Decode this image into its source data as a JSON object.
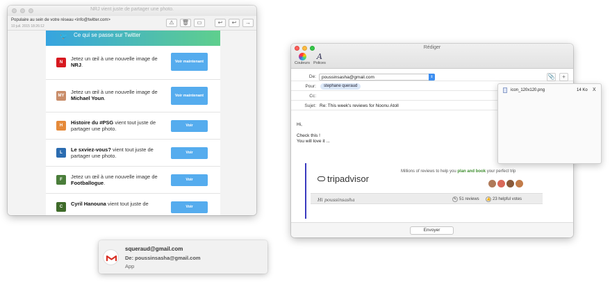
{
  "mail_viewer": {
    "window_title": "NRJ vient juste de partager une photo.",
    "from": "Populaire au sein de votre réseau <info@twitter.com>",
    "date": "10 juil. 2015 18:26:12",
    "toolbar_icons": [
      "warning-icon",
      "trash-icon",
      "folder-icon",
      "reply-icon",
      "reply-all-icon",
      "forward-icon"
    ],
    "twitter_banner": "Ce qui se passe sur Twitter",
    "items": [
      {
        "text_before": "Jetez un œil à une nouvelle image de ",
        "bold": "NRJ",
        "text_after": ".",
        "button": "Voir maintenant"
      },
      {
        "text_before": "Jetez un œil à une nouvelle image de ",
        "bold": "Michael Youn",
        "text_after": ".",
        "button": "Voir maintenant"
      },
      {
        "text_before": "",
        "bold": "Histoire du #PSG",
        "text_after": " vient tout juste de partager une photo.",
        "button": "Voir"
      },
      {
        "text_before": "",
        "bold": "Le sxviez-vous?",
        "text_after": " vient tout juste de partager une photo.",
        "button": "Voir"
      },
      {
        "text_before": "Jetez un œil à une nouvelle image de ",
        "bold": "Footballogue",
        "text_after": ".",
        "button": "Voir"
      },
      {
        "text_before": "",
        "bold": "Cyril Hanouna",
        "text_after": " vient tout juste de",
        "button": "Voir"
      }
    ]
  },
  "compose": {
    "window_title": "Rédiger",
    "tools": {
      "colors": "Couleurs",
      "fonts": "Polices"
    },
    "labels": {
      "from": "De:",
      "to": "Pour:",
      "cc": "Cc:",
      "subject": "Sujet:"
    },
    "from_value": "poussinsasha@gmail.com",
    "to_token": "stephane queraud",
    "cc_value": "",
    "subject_value": "Re: This week's reviews for Noonu Atoll",
    "body_lines": [
      "Hi,",
      "",
      "Check this !",
      "You will love it ..."
    ],
    "tripadvisor": {
      "logo": "tripadvisor",
      "tagline_before": "Millions of reviews to help you ",
      "tagline_bold": "plan and book",
      "tagline_after": " your perfect trip",
      "greeting": "Hi poussinsasha",
      "reviews": "51 reviews",
      "helpful": "23 helpful votes"
    },
    "send_button": "Envoyer"
  },
  "attachment": {
    "name": "icon_120x120.png",
    "size": "14 Ko",
    "remove": "X"
  },
  "notification": {
    "title": "squeraud@gmail.com",
    "subtitle": "De: poussinsasha@gmail.com",
    "app": "App"
  }
}
